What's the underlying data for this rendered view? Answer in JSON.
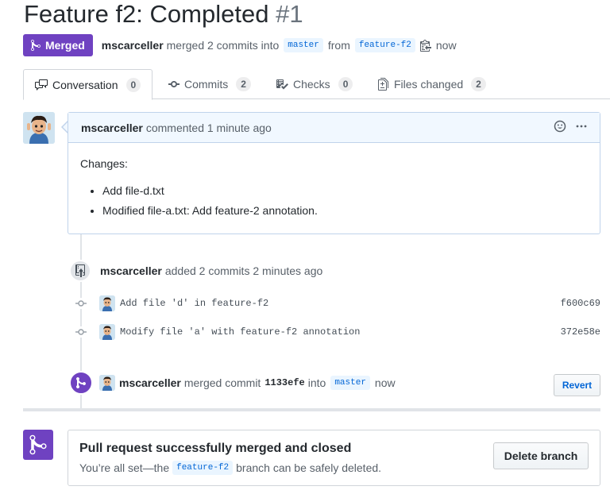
{
  "pr": {
    "title": "Feature f2: Completed",
    "number": "#1",
    "state_label": "Merged",
    "author": "mscarceller",
    "merged_text": "merged 2 commits into",
    "base_branch": "master",
    "from_text": "from",
    "head_branch": "feature-f2",
    "time": "now"
  },
  "tabs": [
    {
      "label": "Conversation",
      "count": "0"
    },
    {
      "label": "Commits",
      "count": "2"
    },
    {
      "label": "Checks",
      "count": "0"
    },
    {
      "label": "Files changed",
      "count": "2"
    }
  ],
  "comment": {
    "author": "mscarceller",
    "action": "commented 1 minute ago",
    "intro": "Changes:",
    "items": [
      "Add file-d.txt",
      "Modified file-a.txt: Add feature-2 annotation."
    ]
  },
  "commits_event": {
    "author": "mscarceller",
    "action": "added 2 commits 2 minutes ago",
    "commits": [
      {
        "message": "Add file 'd' in feature-f2",
        "sha": "f600c69"
      },
      {
        "message": "Modify file 'a' with feature-f2 annotation",
        "sha": "372e58e"
      }
    ]
  },
  "merge_event": {
    "author": "mscarceller",
    "action": "merged commit",
    "sha": "1133efe",
    "into": "into",
    "branch": "master",
    "time": "now",
    "revert_label": "Revert"
  },
  "merge_box": {
    "title": "Pull request successfully merged and closed",
    "sub_before": "You’re all set—the",
    "branch": "feature-f2",
    "sub_after": "branch can be safely deleted.",
    "delete_label": "Delete branch"
  },
  "colors": {
    "merged": "#6f42c1",
    "link": "#0366d6",
    "comment_header": "#f1f8ff"
  }
}
